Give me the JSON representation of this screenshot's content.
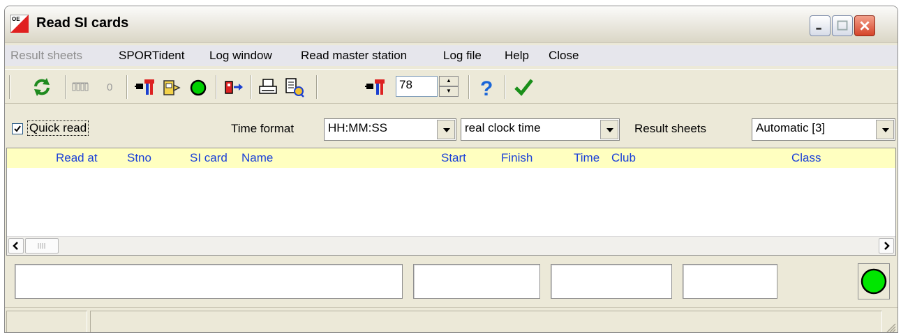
{
  "window": {
    "title": "Read SI cards",
    "app_icon_letters": "OE"
  },
  "menu": {
    "items": [
      {
        "label": "Result sheets",
        "enabled": false
      },
      {
        "label": "SPORTident",
        "enabled": true
      },
      {
        "label": "Log window",
        "enabled": true
      },
      {
        "label": "Read master station",
        "enabled": true
      },
      {
        "label": "Log file",
        "enabled": true
      },
      {
        "label": "Help",
        "enabled": true
      },
      {
        "label": "Close",
        "enabled": true
      }
    ]
  },
  "toolbar": {
    "counter_label": "0",
    "spin_value": "78",
    "icons": [
      "refresh-icon",
      "counter-icon",
      "station-config-icon",
      "punch-icon",
      "status-green-icon",
      "card-exit-icon",
      "print-icon",
      "print-preview-icon",
      "station-config-icon-2",
      "help-icon",
      "confirm-icon"
    ]
  },
  "options": {
    "quick_read_label": "Quick read",
    "quick_read_checked": true,
    "time_format_label": "Time format",
    "time_format_value": "HH:MM:SS",
    "clock_value": "real clock time",
    "result_sheets_label": "Result sheets",
    "result_sheets_value": "Automatic [3]"
  },
  "table": {
    "columns": [
      "Read at",
      "Stno",
      "SI card",
      "Name",
      "Start",
      "Finish",
      "Time",
      "Club",
      "Class"
    ],
    "rows": []
  },
  "status": {
    "light_color": "#00e600"
  },
  "colors": {
    "header_bg": "#ffffc0",
    "header_text": "#1a40d8",
    "window_bg": "#ece9d8"
  }
}
